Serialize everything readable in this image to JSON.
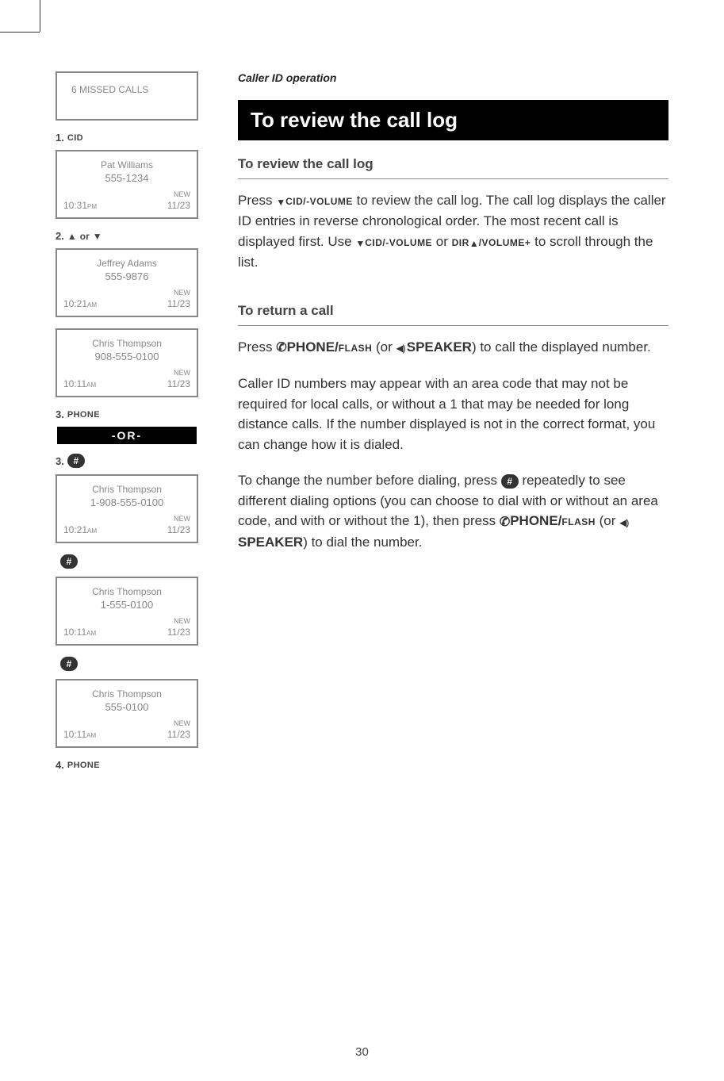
{
  "header": {
    "section": "Caller ID operation",
    "title": "To review the call log"
  },
  "page_number": "30",
  "sections": {
    "review": {
      "head": "To review the call log",
      "p1a": "Press ",
      "p1b": " to review the call log. The call log displays the caller ID entries in reverse chronological order.  The most recent call is displayed first. Use ",
      "p1c": " or ",
      "p1d": " to scroll through the list."
    },
    "return": {
      "head": "To return a call",
      "p1a": "Press ",
      "p1b": " (or ",
      "p1c": ") to call the displayed number.",
      "p2": "Caller ID numbers may appear with an area code that may not be required for local calls, or without a 1 that may be needed for long distance calls. If the number displayed is not in the correct format, you can change how it is dialed.",
      "p3a": "To change the number before dialing, press ",
      "p3b": " repeatedly to see different dialing options (you can choose to dial with or without an area code, and with or without the 1), then press ",
      "p3c": " (or ",
      "p3d": ") to dial the number."
    }
  },
  "keys": {
    "cid_vol": "CID/-VOLUME",
    "dir": "DIR",
    "vol_plus": "/VOLUME+",
    "phone": "PHONE/",
    "flash": "FLASH",
    "speaker": "SPEAKER",
    "hash": "#"
  },
  "sidebar": {
    "screens": {
      "missed": {
        "line": "6 MISSED CALLS"
      },
      "s1": {
        "name": "Pat Williams",
        "number": "555-1234",
        "new": "NEW",
        "time": "10:31",
        "ampm": "PM",
        "date": "11/23"
      },
      "s2a": {
        "name": "Jeffrey Adams",
        "number": "555-9876",
        "new": "NEW",
        "time": "10:21",
        "ampm": "AM",
        "date": "11/23"
      },
      "s2b": {
        "name": "Chris Thompson",
        "number": "908-555-0100",
        "new": "NEW",
        "time": "10:11",
        "ampm": "AM",
        "date": "11/23"
      },
      "s4": {
        "name": "Chris Thompson",
        "number": "1-908-555-0100",
        "new": "NEW",
        "time": "10:21",
        "ampm": "AM",
        "date": "11/23"
      },
      "s5": {
        "name": "Chris Thompson",
        "number": "1-555-0100",
        "new": "NEW",
        "time": "10:11",
        "ampm": "AM",
        "date": "11/23"
      },
      "s6": {
        "name": "Chris Thompson",
        "number": "555-0100",
        "new": "NEW",
        "time": "10:11",
        "ampm": "AM",
        "date": "11/23"
      }
    },
    "steps": {
      "s1": {
        "n": "1.",
        "label": "CID"
      },
      "s2": {
        "n": "2.",
        "mid": "or"
      },
      "s3a": {
        "n": "3.",
        "label": "PHONE"
      },
      "or": "-OR-",
      "s3b": {
        "n": "3."
      },
      "s4": {
        "n": "4.",
        "label": "PHONE"
      }
    }
  }
}
